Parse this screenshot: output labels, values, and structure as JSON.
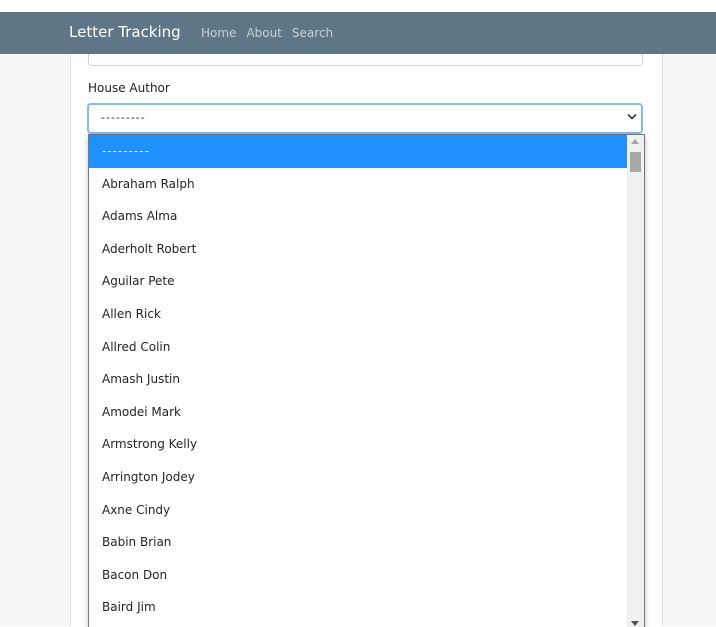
{
  "navbar": {
    "brand": "Letter Tracking",
    "links": [
      "Home",
      "About",
      "Search"
    ]
  },
  "form": {
    "house_author": {
      "label": "House Author",
      "selected_value": "---------",
      "options": [
        "---------",
        "Abraham Ralph",
        "Adams Alma",
        "Aderholt Robert",
        "Aguilar Pete",
        "Allen Rick",
        "Allred Colin",
        "Amash Justin",
        "Amodei Mark",
        "Armstrong Kelly",
        "Arrington Jodey",
        "Axne Cindy",
        "Babin Brian",
        "Bacon Don",
        "Baird Jim"
      ]
    }
  },
  "colors": {
    "navbar": "#5f7687",
    "selected_option": "#1e90ff",
    "focus_border": "#86b7fe"
  },
  "icons": {
    "select_arrow": "chevron-down-icon",
    "scroll_up": "scroll-up-arrow-icon",
    "scroll_down": "scroll-down-arrow-icon"
  }
}
